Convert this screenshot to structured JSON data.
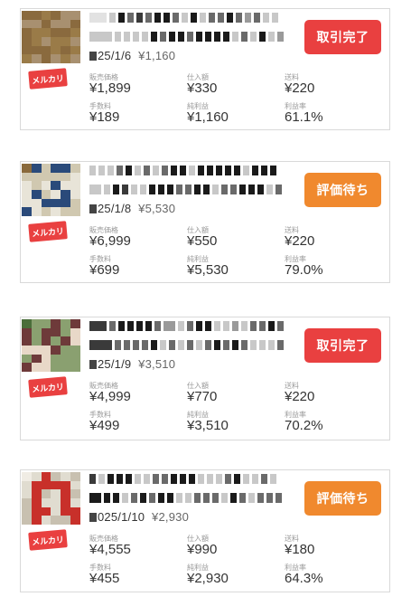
{
  "colors": {
    "done": "#e94040",
    "waiting": "#f0892e",
    "badge": "#e94040"
  },
  "labels": {
    "sale_price": "販売価格",
    "purchase": "仕入額",
    "shipping": "送料",
    "fee": "手数料",
    "net_profit": "純利益",
    "margin": "利益率"
  },
  "cards": [
    {
      "date": "25/1/6",
      "profit_short": "¥1,160",
      "badge": "メルカリ",
      "status": "取引完了",
      "status_kind": "done",
      "sale_price": "¥1,899",
      "purchase": "¥330",
      "shipping": "¥220",
      "fee": "¥189",
      "net_profit": "¥1,160",
      "margin": "61.1%"
    },
    {
      "date": "25/1/8",
      "profit_short": "¥5,530",
      "badge": "メルカリ",
      "status": "評価待ち",
      "status_kind": "waiting",
      "sale_price": "¥6,999",
      "purchase": "¥550",
      "shipping": "¥220",
      "fee": "¥699",
      "net_profit": "¥5,530",
      "margin": "79.0%"
    },
    {
      "date": "25/1/9",
      "profit_short": "¥3,510",
      "badge": "メルカリ",
      "status": "取引完了",
      "status_kind": "done",
      "sale_price": "¥4,999",
      "purchase": "¥770",
      "shipping": "¥220",
      "fee": "¥499",
      "net_profit": "¥3,510",
      "margin": "70.2%"
    },
    {
      "date": "025/1/10",
      "profit_short": "¥2,930",
      "badge": "メルカリ",
      "status": "評価待ち",
      "status_kind": "waiting",
      "sale_price": "¥4,555",
      "purchase": "¥990",
      "shipping": "¥180",
      "fee": "¥455",
      "net_profit": "¥2,930",
      "margin": "64.3%"
    }
  ]
}
